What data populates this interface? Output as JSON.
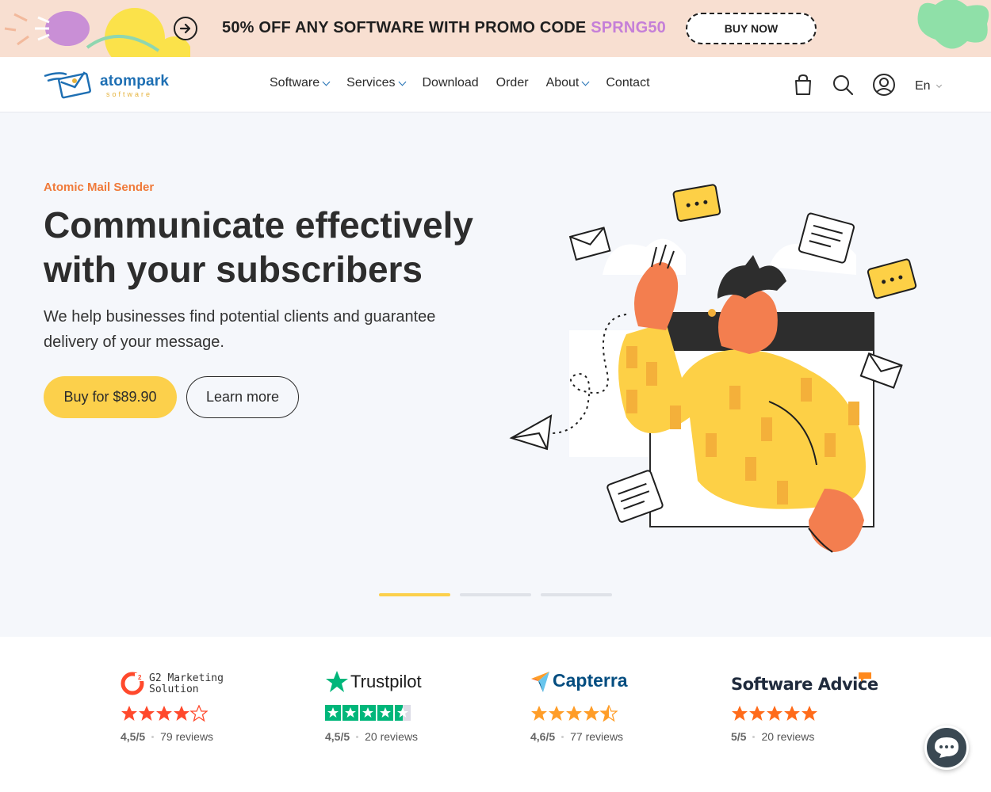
{
  "promo": {
    "text": "50% OFF ANY SOFTWARE WITH PROMO CODE ",
    "code": "SPRNG50",
    "button": "BUY NOW",
    "code_color": "#c57fd8"
  },
  "header": {
    "logo_name": "atompark",
    "logo_sub": "software",
    "nav": [
      "Software",
      "Services",
      "Download",
      "Order",
      "About",
      "Contact"
    ],
    "nav_dropdowns": [
      true,
      true,
      false,
      false,
      true,
      false
    ],
    "icons": [
      "cart-icon",
      "search-icon",
      "account-icon"
    ],
    "language": "En"
  },
  "hero": {
    "eyebrow": "Atomic Mail Sender",
    "headline": "Communicate effectively with your subscribers",
    "subtext": "We help businesses find potential clients and guarantee delivery of your message.",
    "buy_button": "Buy for $89.90",
    "learn_button": "Learn more",
    "slides_total": 3,
    "slide_active": 1,
    "accent": "#fcd04b",
    "eyebrow_color": "#f07a3a"
  },
  "reviews": [
    {
      "brand": "G2",
      "label_line1": "G2 Marketing",
      "label_line2": "Solution",
      "score": "4,5/5",
      "reviews": "79 reviews",
      "stars": 4
    },
    {
      "brand": "Trustpilot",
      "label_line1": "Trustpilot",
      "score": "4,5/5",
      "reviews": "20 reviews",
      "stars": 4.5
    },
    {
      "brand": "Capterra",
      "label_line1": "Capterra",
      "score": "4,6/5",
      "reviews": "77 reviews",
      "stars": 4.5
    },
    {
      "brand": "Software Advice",
      "label_line1": "Software Advice",
      "score": "5/5",
      "reviews": "20 reviews",
      "stars": 5
    }
  ],
  "chat": {
    "icon": "chat-icon"
  }
}
